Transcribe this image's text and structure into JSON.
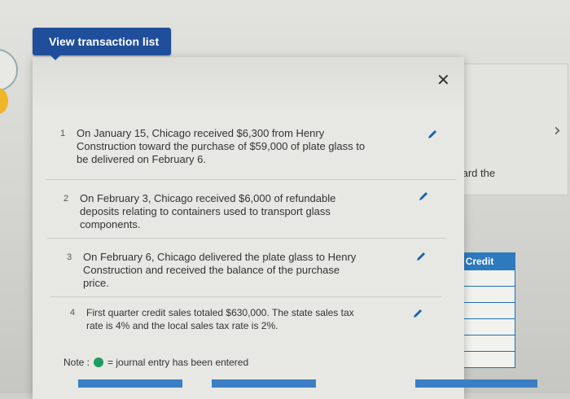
{
  "header": {
    "view_button_label": "View transaction list"
  },
  "modal": {
    "close_glyph": "✕",
    "transactions": [
      {
        "number": "1",
        "text": "On January 15, Chicago received $6,300 from Henry Construction toward the purchase of $59,000 of plate glass to be delivered on February 6."
      },
      {
        "number": "2",
        "text": "On February 3, Chicago received $6,000 of refundable deposits relating to containers used to transport glass components."
      },
      {
        "number": "3",
        "text": "On February 6, Chicago delivered the plate glass to Henry Construction and received the balance of the purchase price."
      },
      {
        "number": "4",
        "text": "First quarter credit sales totaled $630,000. The state sales tax rate is 4% and the local sales tax rate is 2%."
      }
    ],
    "note_label": "Note :",
    "note_text": "= journal entry has been entered"
  },
  "background_panel": {
    "partial_text": "/ard the",
    "credit_header": "Credit"
  },
  "colors": {
    "button_blue": "#1f4e9a",
    "credit_blue": "#2d7abf",
    "pencil_blue": "#1a5fb0",
    "entered_green": "#1f9a60"
  },
  "icons": {
    "edit": "pencil-icon",
    "close": "close-icon",
    "next": "chevron-right-icon"
  }
}
